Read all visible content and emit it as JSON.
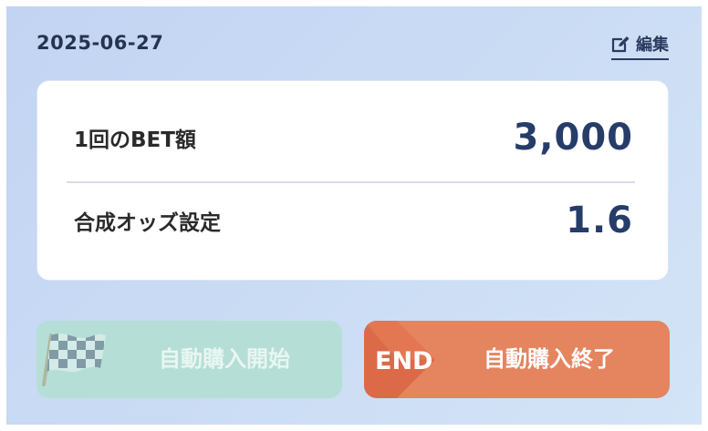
{
  "header": {
    "date": "2025-06-27",
    "edit_label": "編集"
  },
  "settings": {
    "bet_amount_label": "1回のBET額",
    "bet_amount_value": "3,000",
    "odds_label": "合成オッズ設定",
    "odds_value": "1.6"
  },
  "actions": {
    "start_label": "自動購入開始",
    "start_enabled": false,
    "end_label": "自動購入終了",
    "end_icon_text": "END"
  },
  "colors": {
    "accent_navy": "#263c69",
    "start_button": "#b5dfd6",
    "end_button": "#e48560"
  },
  "icons": {
    "edit": "edit-icon",
    "start": "checkered-flag-icon",
    "end": "end-icon"
  }
}
